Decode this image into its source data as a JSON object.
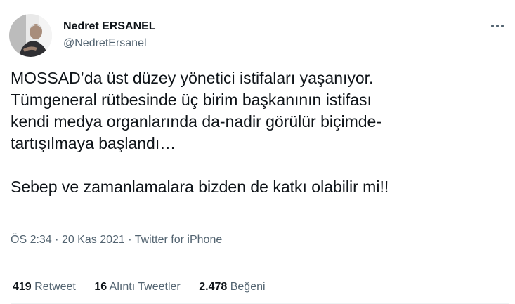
{
  "user": {
    "name": "Nedret ERSANEL",
    "handle": "@NedretErsanel"
  },
  "tweet": {
    "lines": [
      "MOSSAD’da üst düzey yönetici istifaları yaşanıyor.",
      "Tümgeneral rütbesinde üç birim başkanının istifası",
      "kendi medya organlarında da-nadir görülür biçimde-",
      "tartışılmaya başlandı…",
      "Sebep ve zamanlamalara bizden de katkı olabilir mi!!"
    ]
  },
  "meta": {
    "time": "ÖS 2:34",
    "date": "20 Kas 2021",
    "separator": "·",
    "source": "Twitter for iPhone"
  },
  "stats": {
    "retweets": {
      "count": "419",
      "label": "Retweet"
    },
    "quotes": {
      "count": "16",
      "label": "Alıntı Tweetler"
    },
    "likes": {
      "count": "2.478",
      "label": "Beğeni"
    }
  },
  "icons": {
    "more": "more-horizontal-icon"
  },
  "colors": {
    "text_primary": "#0f1419",
    "text_secondary": "#536471",
    "divider": "#eff3f4"
  }
}
